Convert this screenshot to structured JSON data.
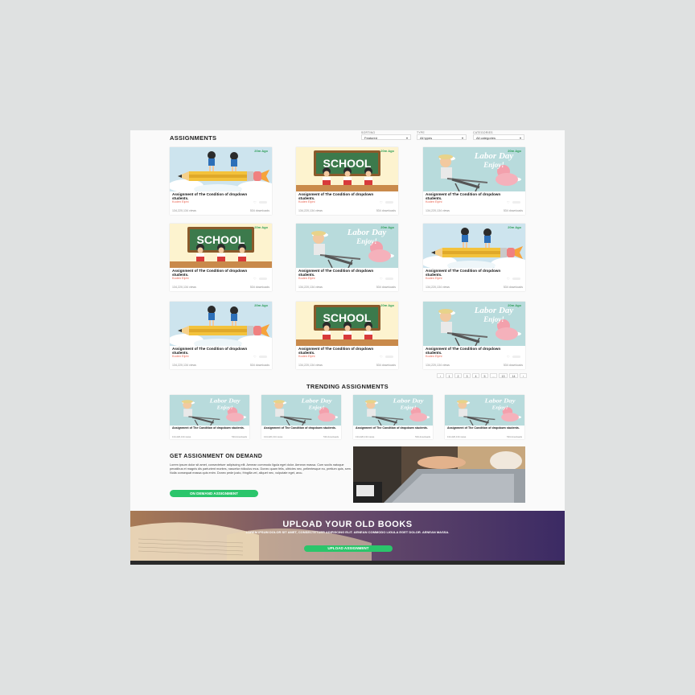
{
  "header": {
    "title": "ASSIGNMENTS"
  },
  "filters": [
    {
      "label": "SORTING",
      "value": "Featured"
    },
    {
      "label": "TYPE",
      "value": "All types"
    },
    {
      "label": "CATEGORIES",
      "value": "All categories"
    }
  ],
  "cards": [
    {
      "img": "pencil",
      "ago": "20m Ago",
      "title": "Assignment of The Condition of dropdown students.",
      "author": "Koden Elphi",
      "views": "134,220,134 views",
      "downloads": "534 downloads"
    },
    {
      "img": "school",
      "ago": "20m Ago",
      "title": "Assignment of The Condition of dropdown students.",
      "author": "Koden Elphi",
      "views": "134,220,134 views",
      "downloads": "534 downloads"
    },
    {
      "img": "labor",
      "ago": "20m Ago",
      "title": "Assignment of The Condition of dropdown students.",
      "author": "Koden Elphi",
      "views": "134,220,134 views",
      "downloads": "534 downloads"
    },
    {
      "img": "school",
      "ago": "20m Ago",
      "title": "Assignment of The Condition of dropdown students.",
      "author": "Koden Elphi",
      "views": "134,220,134 views",
      "downloads": "534 downloads"
    },
    {
      "img": "labor",
      "ago": "20m Ago",
      "title": "Assignment of The Condition of dropdown students.",
      "author": "Koden Elphi",
      "views": "134,220,134 views",
      "downloads": "534 downloads"
    },
    {
      "img": "pencil",
      "ago": "20m Ago",
      "title": "Assignment of The Condition of dropdown students.",
      "author": "Koden Elphi",
      "views": "134,220,134 views",
      "downloads": "534 downloads"
    },
    {
      "img": "pencil",
      "ago": "20m Ago",
      "title": "Assignment of The Condition of dropdown students.",
      "author": "Koden Elphi",
      "views": "134,220,134 views",
      "downloads": "534 downloads"
    },
    {
      "img": "school",
      "ago": "20m Ago",
      "title": "Assignment of The Condition of dropdown students.",
      "author": "Koden Elphi",
      "views": "134,220,134 views",
      "downloads": "534 downloads"
    },
    {
      "img": "labor",
      "ago": "20m Ago",
      "title": "Assignment of The Condition of dropdown students.",
      "author": "Koden Elphi",
      "views": "134,220,134 views",
      "downloads": "534 downloads"
    }
  ],
  "pagination": [
    "‹",
    "1",
    "2",
    "3",
    "4",
    "5",
    "...",
    "13",
    "14",
    "›"
  ],
  "trending": {
    "title": "TRENDING ASSIGNMENTS",
    "items": [
      {
        "title": "Assignment of The Condition of dropdown students.",
        "views": "134,220,134 views",
        "downloads": "534 downloads"
      },
      {
        "title": "Assignment of The Condition of dropdown students.",
        "views": "134,220,134 views",
        "downloads": "534 downloads"
      },
      {
        "title": "Assignment of The Condition of dropdown students.",
        "views": "134,220,134 views",
        "downloads": "534 downloads"
      },
      {
        "title": "Assignment of The Condition of dropdown students.",
        "views": "134,220,134 views",
        "downloads": "534 downloads"
      }
    ]
  },
  "on_demand": {
    "title": "GET ASSIGNMENT ON DEMAND",
    "body": "Lorem ipsum dolor sit amet, consectetuer adipiscing elit. Aenean commodo ligula eget dolor. Aenean massa. Cum sociis natoque penatibus et magnis dis parturient montes, nascetur ridiculus mus. Donec quam felis, ultricies nec, pellentesque eu, pretium quis, sem. Nulla consequat massa quis enim. Donec pede justo, fringilla vel, aliquet nec, vulputate eget, arcu.",
    "button": "ON DEMAND ASSIGNMENT"
  },
  "upload": {
    "title": "UPLOAD YOUR OLD BOOKS",
    "subtitle": "LOREM IPSUM DOLOR SIT AMET, CONSECTETUER ADIPISCING ELIT. AENEAN COMMODO LIGULA EGET DOLOR. AENEAN MASSA.",
    "button": "UPLOAD ASSIGNMENT"
  },
  "thumb_text": {
    "school": "SCHOOL",
    "labor_line1": "Labor Day",
    "labor_line2": "Enjoy!"
  },
  "colors": {
    "accent_green": "#2bc56b",
    "author_red": "#e9624e",
    "board_green": "#3c7a4c"
  }
}
